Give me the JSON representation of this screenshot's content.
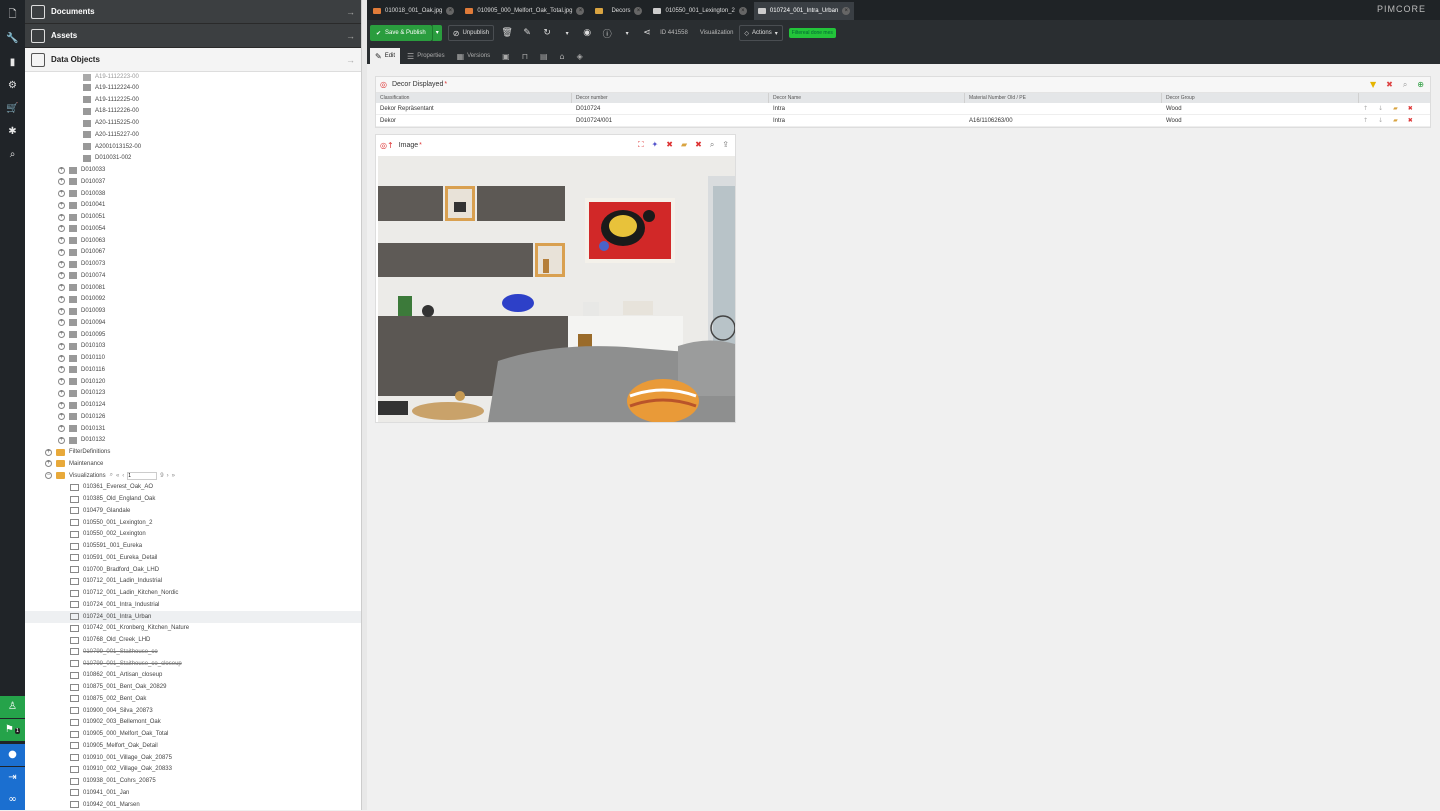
{
  "rail": {
    "icons": [
      "file-icon",
      "wrench-icon",
      "chart-icon",
      "gear-icon",
      "cart-icon",
      "network-icon",
      "search-icon"
    ],
    "bottom_icons": [
      "user-badge-icon",
      "notification-icon",
      "profile-icon",
      "logout-icon",
      "pimcore-logo-icon"
    ],
    "notification_count": "1"
  },
  "accordion": {
    "documents": "Documents",
    "assets": "Assets",
    "data_objects": "Data Objects"
  },
  "tree": {
    "leaf_items": [
      "A19-1112224-00",
      "A19-1112225-00",
      "A18-1112226-00",
      "A20-1115225-00",
      "A20-1115227-00",
      "A2001013152-00",
      "D010031-002"
    ],
    "folders": [
      "D010033",
      "D010037",
      "D010038",
      "D010041",
      "D010051",
      "D010054",
      "D010063",
      "D010067",
      "D010073",
      "D010074",
      "D010081",
      "D010092",
      "D010093",
      "D010094",
      "D010095",
      "D010103",
      "D010110",
      "D010116",
      "D010120",
      "D010123",
      "D010124",
      "D010126",
      "D010131",
      "D010132"
    ],
    "filter_definitions": "FilterDefinitions",
    "maintenance": "Maintenance",
    "visualizations": "Visualizations",
    "pager_value": "1",
    "pager_total": "9",
    "visualization_items": [
      {
        "label": "010361_Everest_Oak_AO",
        "strike": false,
        "selected": false
      },
      {
        "label": "010385_Old_England_Oak",
        "strike": false,
        "selected": false
      },
      {
        "label": "010479_Glandale",
        "strike": false,
        "selected": false
      },
      {
        "label": "010550_001_Lexington_2",
        "strike": false,
        "selected": false
      },
      {
        "label": "010550_002_Lexington",
        "strike": false,
        "selected": false
      },
      {
        "label": "0105591_001_Eureka",
        "strike": false,
        "selected": false
      },
      {
        "label": "010591_001_Eureka_Detail",
        "strike": false,
        "selected": false
      },
      {
        "label": "010700_Bradford_Oak_LHD",
        "strike": false,
        "selected": false
      },
      {
        "label": "010712_001_Ladin_Industrial",
        "strike": false,
        "selected": false
      },
      {
        "label": "010712_001_Ladin_Kitchen_Nordic",
        "strike": false,
        "selected": false
      },
      {
        "label": "010724_001_Intra_Industrial",
        "strike": false,
        "selected": false
      },
      {
        "label": "010724_001_Intra_Urban",
        "strike": false,
        "selected": true
      },
      {
        "label": "010742_001_Kronberg_Kitchen_Nature",
        "strike": false,
        "selected": false
      },
      {
        "label": "010768_Old_Creek_LHD",
        "strike": false,
        "selected": false
      },
      {
        "label": "010799_001_Staithouse_co",
        "strike": true,
        "selected": false
      },
      {
        "label": "010799_001_Staithouse_co_closeup",
        "strike": true,
        "selected": false
      },
      {
        "label": "010862_001_Artisan_closeup",
        "strike": false,
        "selected": false
      },
      {
        "label": "010875_001_Bent_Oak_20829",
        "strike": false,
        "selected": false
      },
      {
        "label": "010875_002_Bent_Oak",
        "strike": false,
        "selected": false
      },
      {
        "label": "010900_004_Silva_20873",
        "strike": false,
        "selected": false
      },
      {
        "label": "010902_003_Bellemont_Oak",
        "strike": false,
        "selected": false
      },
      {
        "label": "010905_000_Melfort_Oak_Total",
        "strike": false,
        "selected": false
      },
      {
        "label": "010905_Melfort_Oak_Detail",
        "strike": false,
        "selected": false
      },
      {
        "label": "010910_001_Village_Oak_20875",
        "strike": false,
        "selected": false
      },
      {
        "label": "010910_002_Village_Oak_20833",
        "strike": false,
        "selected": false
      },
      {
        "label": "010938_001_Cohrs_20875",
        "strike": false,
        "selected": false
      },
      {
        "label": "010941_001_Jan",
        "strike": false,
        "selected": false
      },
      {
        "label": "010942_001_Marsen",
        "strike": false,
        "selected": false
      }
    ]
  },
  "tabs": [
    {
      "label": "010018_001_Oak.jpg",
      "icon": "image",
      "active": false
    },
    {
      "label": "010905_000_Melfort_Oak_Total.jpg",
      "icon": "image",
      "active": false
    },
    {
      "label": "Decors",
      "icon": "folder",
      "active": false
    },
    {
      "label": "010550_001_Lexington_2",
      "icon": "object",
      "active": false
    },
    {
      "label": "010724_001_Intra_Urban",
      "icon": "object",
      "active": true
    }
  ],
  "brand": "PIMCORE",
  "toolbar": {
    "save_publish": "Save & Publish",
    "unpublish": "Unpublish",
    "id_label": "ID 441558",
    "visualization": "Visualization",
    "actions": "Actions",
    "badge": "Filtereal done mes"
  },
  "subtabs": {
    "edit": "Edit",
    "properties": "Properties",
    "versions": "Versions"
  },
  "decor_panel": {
    "title": "Decor Displayed",
    "required_mark": "*",
    "columns": [
      "Classification",
      "Decor number",
      "Decor Name",
      "Material Number Old / PE",
      "Decor Group"
    ],
    "rows": [
      [
        "Dekor Repräsentant",
        "D010724",
        "Intra",
        "",
        "Wood"
      ],
      [
        "Dekor",
        "D010724/001",
        "Intra",
        "A16/1106263/00",
        "Wood"
      ]
    ]
  },
  "image_panel": {
    "title": "Image",
    "required_mark": "*"
  },
  "colors": {
    "accent_green": "#2a9d3e",
    "dark_bg": "#1f2326",
    "selected_row": "#eef0f2"
  }
}
